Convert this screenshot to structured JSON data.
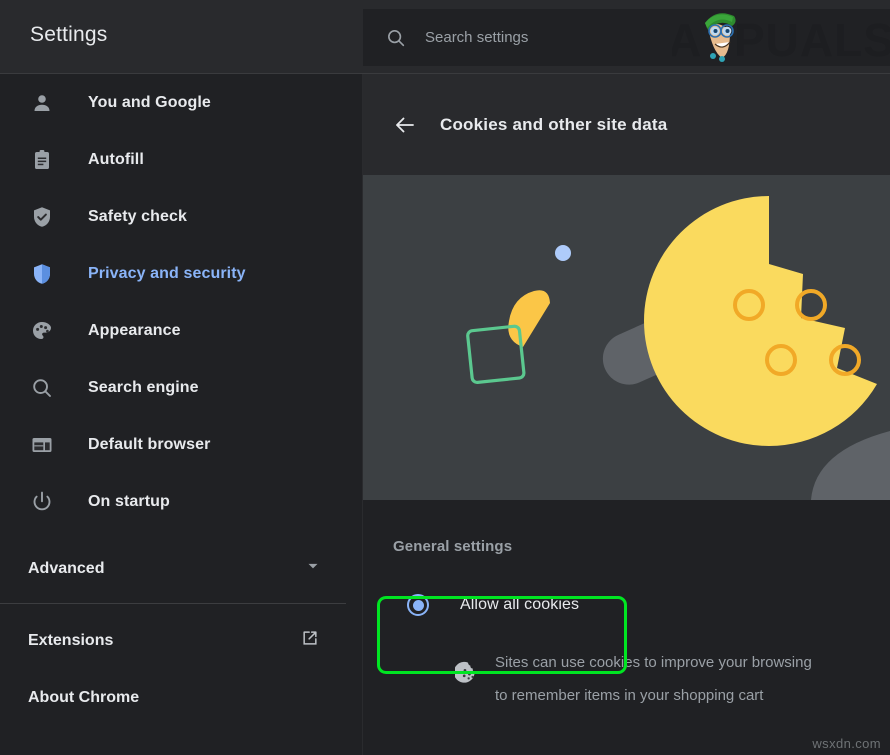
{
  "window": {
    "title": "Settings"
  },
  "search": {
    "placeholder": "Search settings",
    "value": "",
    "icon": "search-icon"
  },
  "brand": {
    "watermark_logo": "APPUALS",
    "logo_text_a": "A",
    "logo_text_rest": "PUALS"
  },
  "sidebar": {
    "items": [
      {
        "label": "You and Google",
        "icon": "person-icon",
        "active": false
      },
      {
        "label": "Autofill",
        "icon": "clipboard-icon",
        "active": false
      },
      {
        "label": "Safety check",
        "icon": "shield-check-icon",
        "active": false
      },
      {
        "label": "Privacy and security",
        "icon": "shield-icon",
        "active": true
      },
      {
        "label": "Appearance",
        "icon": "palette-icon",
        "active": false
      },
      {
        "label": "Search engine",
        "icon": "search-icon",
        "active": false
      },
      {
        "label": "Default browser",
        "icon": "browser-window-icon",
        "active": false
      },
      {
        "label": "On startup",
        "icon": "power-icon",
        "active": false
      }
    ],
    "advanced": {
      "label": "Advanced",
      "icon": "chevron-down-icon"
    },
    "footer": [
      {
        "label": "Extensions",
        "icon": "external-link-icon"
      },
      {
        "label": "About Chrome",
        "icon": ""
      }
    ]
  },
  "page": {
    "back_icon": "arrow-left-icon",
    "title": "Cookies and other site data",
    "section_label": "General settings",
    "options": [
      {
        "label": "Allow all cookies",
        "selected": true,
        "highlighted": true,
        "icon": "cookie-icon",
        "description_line1": "Sites can use cookies to improve your browsing",
        "description_line2": "to remember items in your shopping cart"
      }
    ]
  },
  "colors": {
    "page_bg": "#202124",
    "header_bg": "#292a2d",
    "hero_bg": "#3c4043",
    "accent_blue": "#8ab4f8",
    "text_primary": "#e8eaed",
    "text_secondary": "#9aa0a6",
    "highlight_green": "#00e522",
    "cookie_yellow": "#fada5e",
    "cookie_yellow_dark": "#f5b400",
    "shape_green": "#5bc88f",
    "shape_blue": "#aecbfa",
    "shape_gray": "#5f6368"
  },
  "watermark": {
    "text": "wsxdn.com"
  }
}
